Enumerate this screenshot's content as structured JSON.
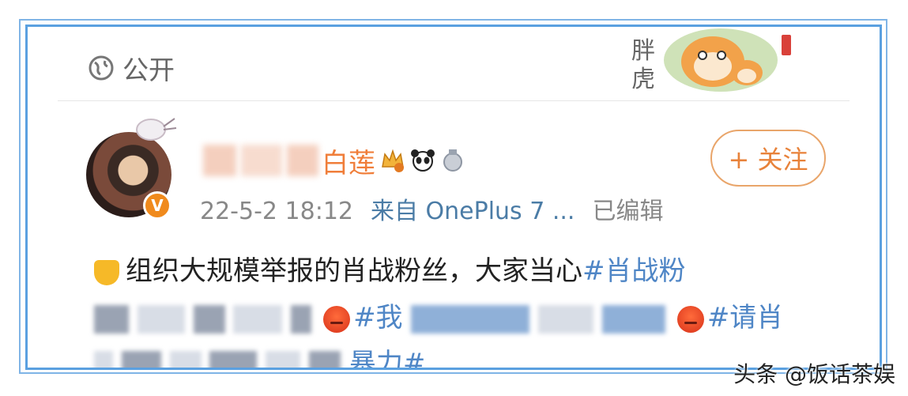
{
  "header": {
    "visibility_label": "公开"
  },
  "sticker": {
    "text": "胖虎"
  },
  "post": {
    "username_visible": "白莲",
    "timestamp": "22-5-2 18:12",
    "source": "来自 OnePlus 7 ...",
    "edited": "已编辑",
    "follow_label": "+ 关注",
    "line1": {
      "text": "组织大规模举报的肖战粉丝，大家当心",
      "hashtag": "#肖战粉"
    },
    "line2": {
      "tag_a": "#我",
      "tag_b": "#请肖"
    },
    "line3": {
      "tail": "暴力#"
    }
  },
  "watermark": "头条 @饭话茶娱",
  "colors": {
    "frame": "#5aa0e0",
    "username": "#f07e3a",
    "hashtag": "#4f86c6",
    "follow": "#e8823a"
  }
}
